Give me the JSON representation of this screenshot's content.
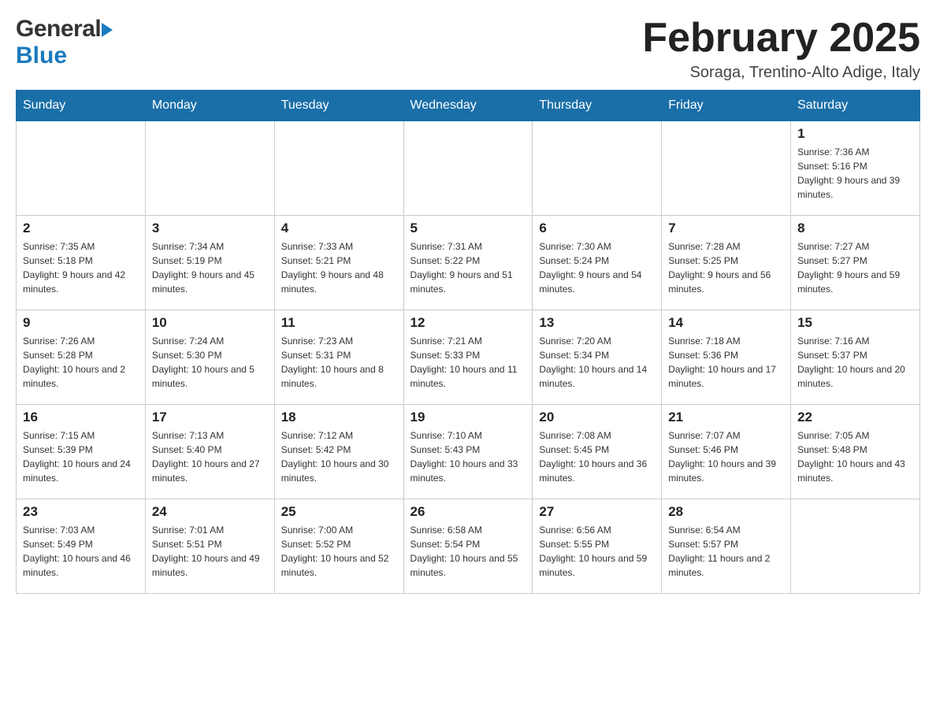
{
  "header": {
    "logo_general": "General",
    "logo_blue": "Blue",
    "month_title": "February 2025",
    "location": "Soraga, Trentino-Alto Adige, Italy"
  },
  "weekdays": [
    "Sunday",
    "Monday",
    "Tuesday",
    "Wednesday",
    "Thursday",
    "Friday",
    "Saturday"
  ],
  "weeks": [
    [
      {
        "day": "",
        "info": ""
      },
      {
        "day": "",
        "info": ""
      },
      {
        "day": "",
        "info": ""
      },
      {
        "day": "",
        "info": ""
      },
      {
        "day": "",
        "info": ""
      },
      {
        "day": "",
        "info": ""
      },
      {
        "day": "1",
        "info": "Sunrise: 7:36 AM\nSunset: 5:16 PM\nDaylight: 9 hours and 39 minutes."
      }
    ],
    [
      {
        "day": "2",
        "info": "Sunrise: 7:35 AM\nSunset: 5:18 PM\nDaylight: 9 hours and 42 minutes."
      },
      {
        "day": "3",
        "info": "Sunrise: 7:34 AM\nSunset: 5:19 PM\nDaylight: 9 hours and 45 minutes."
      },
      {
        "day": "4",
        "info": "Sunrise: 7:33 AM\nSunset: 5:21 PM\nDaylight: 9 hours and 48 minutes."
      },
      {
        "day": "5",
        "info": "Sunrise: 7:31 AM\nSunset: 5:22 PM\nDaylight: 9 hours and 51 minutes."
      },
      {
        "day": "6",
        "info": "Sunrise: 7:30 AM\nSunset: 5:24 PM\nDaylight: 9 hours and 54 minutes."
      },
      {
        "day": "7",
        "info": "Sunrise: 7:28 AM\nSunset: 5:25 PM\nDaylight: 9 hours and 56 minutes."
      },
      {
        "day": "8",
        "info": "Sunrise: 7:27 AM\nSunset: 5:27 PM\nDaylight: 9 hours and 59 minutes."
      }
    ],
    [
      {
        "day": "9",
        "info": "Sunrise: 7:26 AM\nSunset: 5:28 PM\nDaylight: 10 hours and 2 minutes."
      },
      {
        "day": "10",
        "info": "Sunrise: 7:24 AM\nSunset: 5:30 PM\nDaylight: 10 hours and 5 minutes."
      },
      {
        "day": "11",
        "info": "Sunrise: 7:23 AM\nSunset: 5:31 PM\nDaylight: 10 hours and 8 minutes."
      },
      {
        "day": "12",
        "info": "Sunrise: 7:21 AM\nSunset: 5:33 PM\nDaylight: 10 hours and 11 minutes."
      },
      {
        "day": "13",
        "info": "Sunrise: 7:20 AM\nSunset: 5:34 PM\nDaylight: 10 hours and 14 minutes."
      },
      {
        "day": "14",
        "info": "Sunrise: 7:18 AM\nSunset: 5:36 PM\nDaylight: 10 hours and 17 minutes."
      },
      {
        "day": "15",
        "info": "Sunrise: 7:16 AM\nSunset: 5:37 PM\nDaylight: 10 hours and 20 minutes."
      }
    ],
    [
      {
        "day": "16",
        "info": "Sunrise: 7:15 AM\nSunset: 5:39 PM\nDaylight: 10 hours and 24 minutes."
      },
      {
        "day": "17",
        "info": "Sunrise: 7:13 AM\nSunset: 5:40 PM\nDaylight: 10 hours and 27 minutes."
      },
      {
        "day": "18",
        "info": "Sunrise: 7:12 AM\nSunset: 5:42 PM\nDaylight: 10 hours and 30 minutes."
      },
      {
        "day": "19",
        "info": "Sunrise: 7:10 AM\nSunset: 5:43 PM\nDaylight: 10 hours and 33 minutes."
      },
      {
        "day": "20",
        "info": "Sunrise: 7:08 AM\nSunset: 5:45 PM\nDaylight: 10 hours and 36 minutes."
      },
      {
        "day": "21",
        "info": "Sunrise: 7:07 AM\nSunset: 5:46 PM\nDaylight: 10 hours and 39 minutes."
      },
      {
        "day": "22",
        "info": "Sunrise: 7:05 AM\nSunset: 5:48 PM\nDaylight: 10 hours and 43 minutes."
      }
    ],
    [
      {
        "day": "23",
        "info": "Sunrise: 7:03 AM\nSunset: 5:49 PM\nDaylight: 10 hours and 46 minutes."
      },
      {
        "day": "24",
        "info": "Sunrise: 7:01 AM\nSunset: 5:51 PM\nDaylight: 10 hours and 49 minutes."
      },
      {
        "day": "25",
        "info": "Sunrise: 7:00 AM\nSunset: 5:52 PM\nDaylight: 10 hours and 52 minutes."
      },
      {
        "day": "26",
        "info": "Sunrise: 6:58 AM\nSunset: 5:54 PM\nDaylight: 10 hours and 55 minutes."
      },
      {
        "day": "27",
        "info": "Sunrise: 6:56 AM\nSunset: 5:55 PM\nDaylight: 10 hours and 59 minutes."
      },
      {
        "day": "28",
        "info": "Sunrise: 6:54 AM\nSunset: 5:57 PM\nDaylight: 11 hours and 2 minutes."
      },
      {
        "day": "",
        "info": ""
      }
    ]
  ]
}
